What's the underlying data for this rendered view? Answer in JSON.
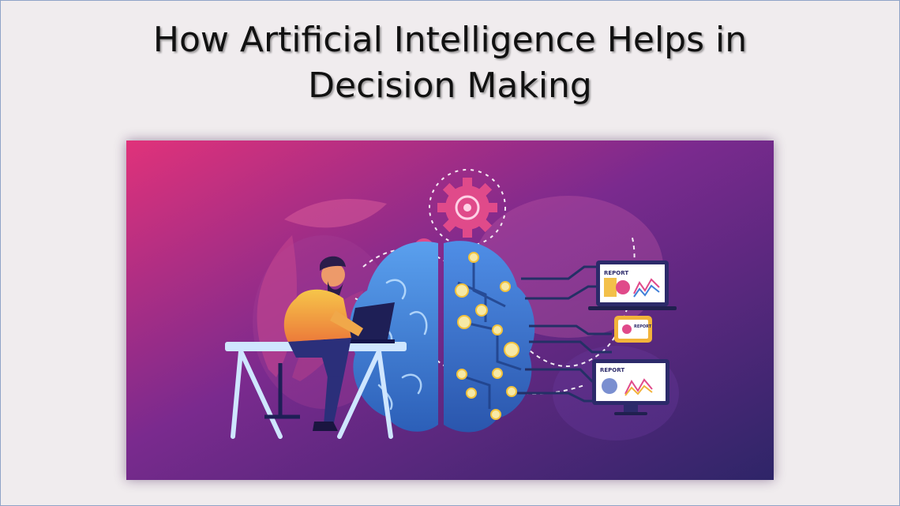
{
  "slide": {
    "title_line1": "How Artificial Intelligence Helps in",
    "title_line2": "Decision Making"
  },
  "illustration": {
    "monitor_top_label": "REPORT",
    "tablet_label": "REPORT",
    "monitor_bottom_label": "REPORT"
  },
  "colors": {
    "background": "#f0ecee",
    "gradient_start": "#e0327a",
    "gradient_mid": "#7a2a8e",
    "gradient_end": "#3a2470",
    "brain": "#3f7fd8",
    "accent_pink": "#e04a8a",
    "person_shirt": "#f2b33a"
  }
}
